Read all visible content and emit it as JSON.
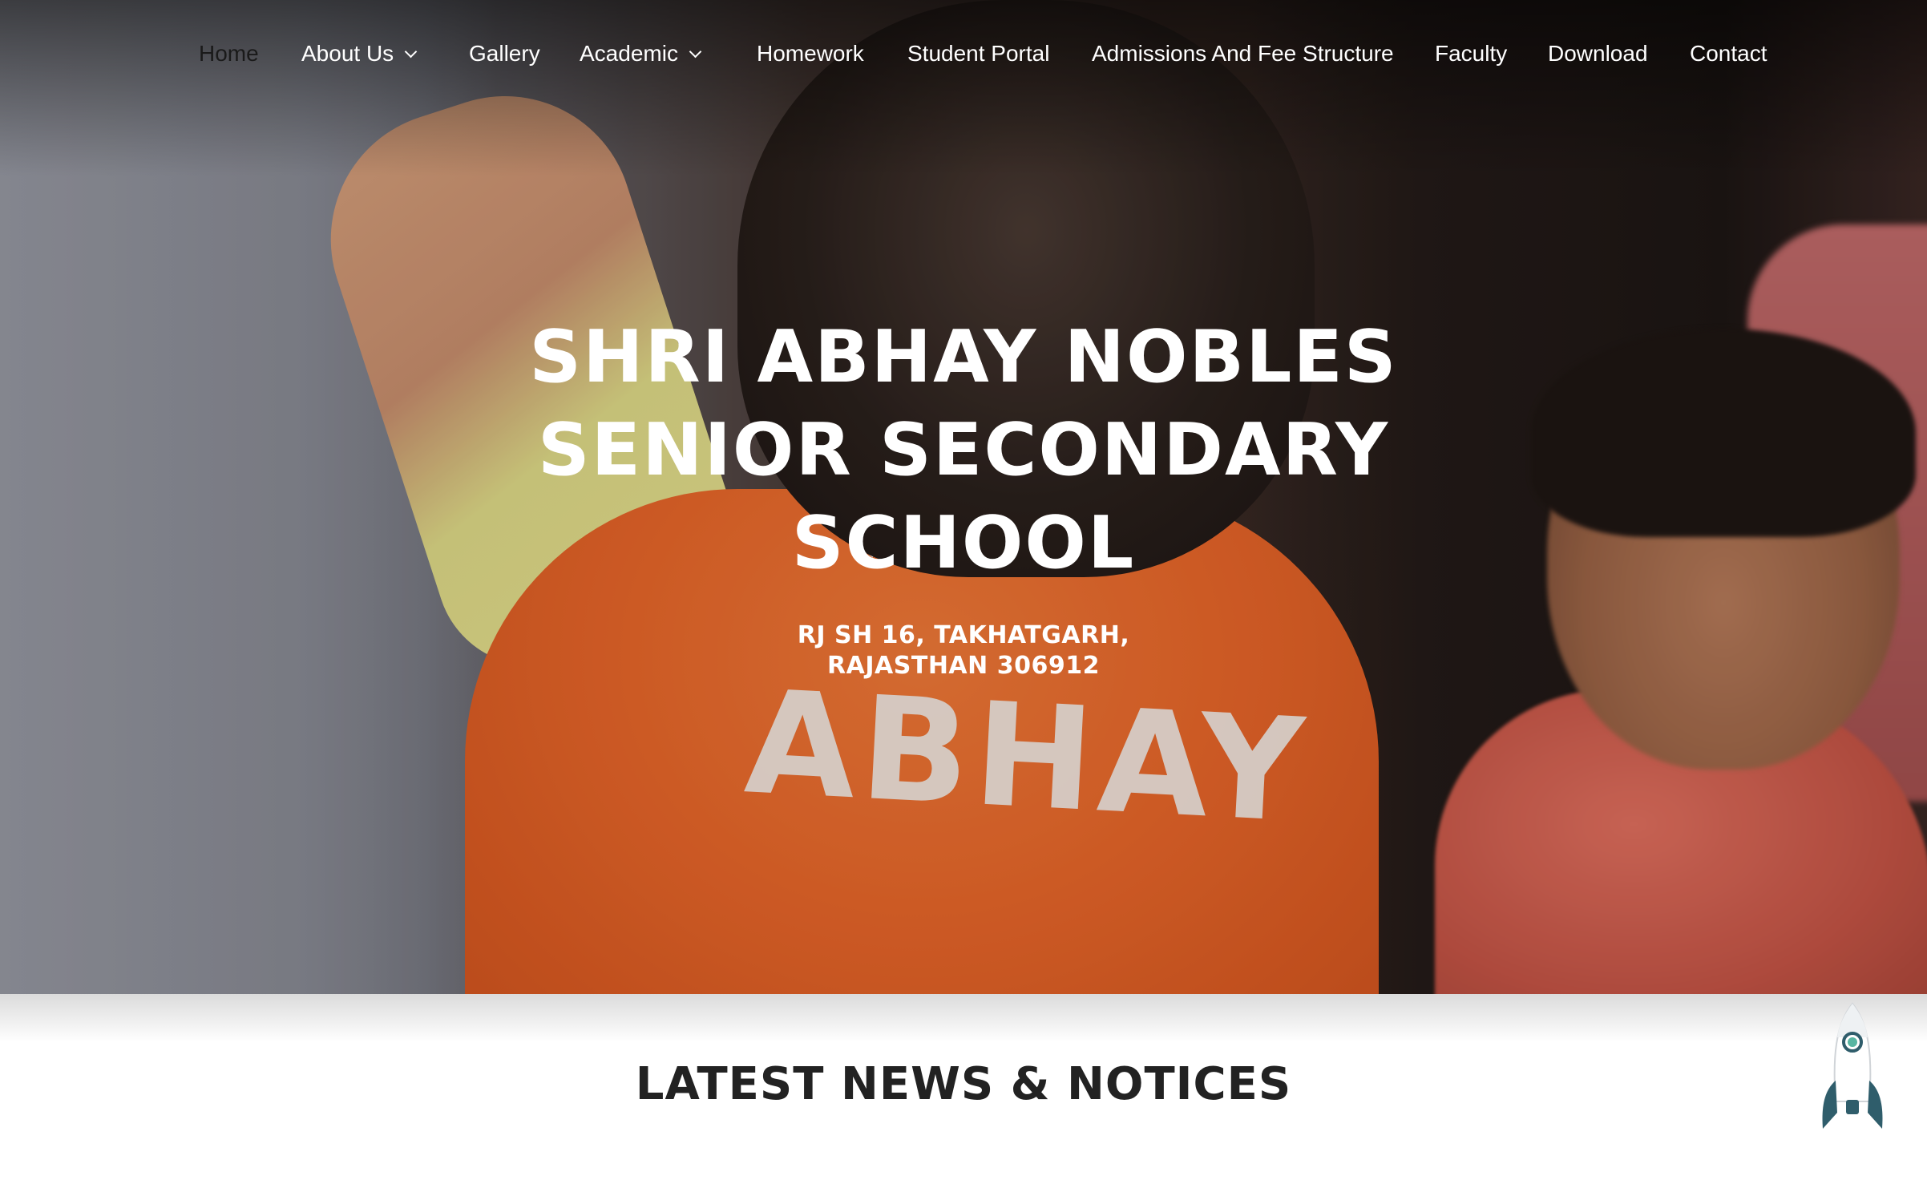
{
  "nav": {
    "items": [
      {
        "label": "Home",
        "dropdown": false
      },
      {
        "label": "About Us",
        "dropdown": true
      },
      {
        "label": "Gallery",
        "dropdown": false
      },
      {
        "label": "Academic",
        "dropdown": true
      },
      {
        "label": "Homework",
        "dropdown": false
      },
      {
        "label": "Student Portal",
        "dropdown": false
      },
      {
        "label": "Admissions And Fee Structure",
        "dropdown": false
      },
      {
        "label": "Faculty",
        "dropdown": false
      },
      {
        "label": "Download",
        "dropdown": false
      },
      {
        "label": "Contact",
        "dropdown": false
      }
    ]
  },
  "hero": {
    "title_lines": [
      "SHRI ABHAY NOBLES",
      "SENIOR SECONDARY",
      "SCHOOL"
    ],
    "address_lines": [
      "RJ SH 16, TAKHATGARH,",
      "RAJASTHAN 306912"
    ],
    "shirt_print": "ABHAY"
  },
  "news": {
    "heading": "LATEST NEWS & NOTICES"
  },
  "icons": {
    "dropdown": "chevron-down-icon",
    "scroll_top": "rocket-icon"
  },
  "colors": {
    "nav_text": "#ffffff",
    "hero_text": "#ffffff",
    "heading_text": "#222222",
    "shirt_orange": "#e9672a",
    "rocket_accent": "#2f5d6b"
  }
}
